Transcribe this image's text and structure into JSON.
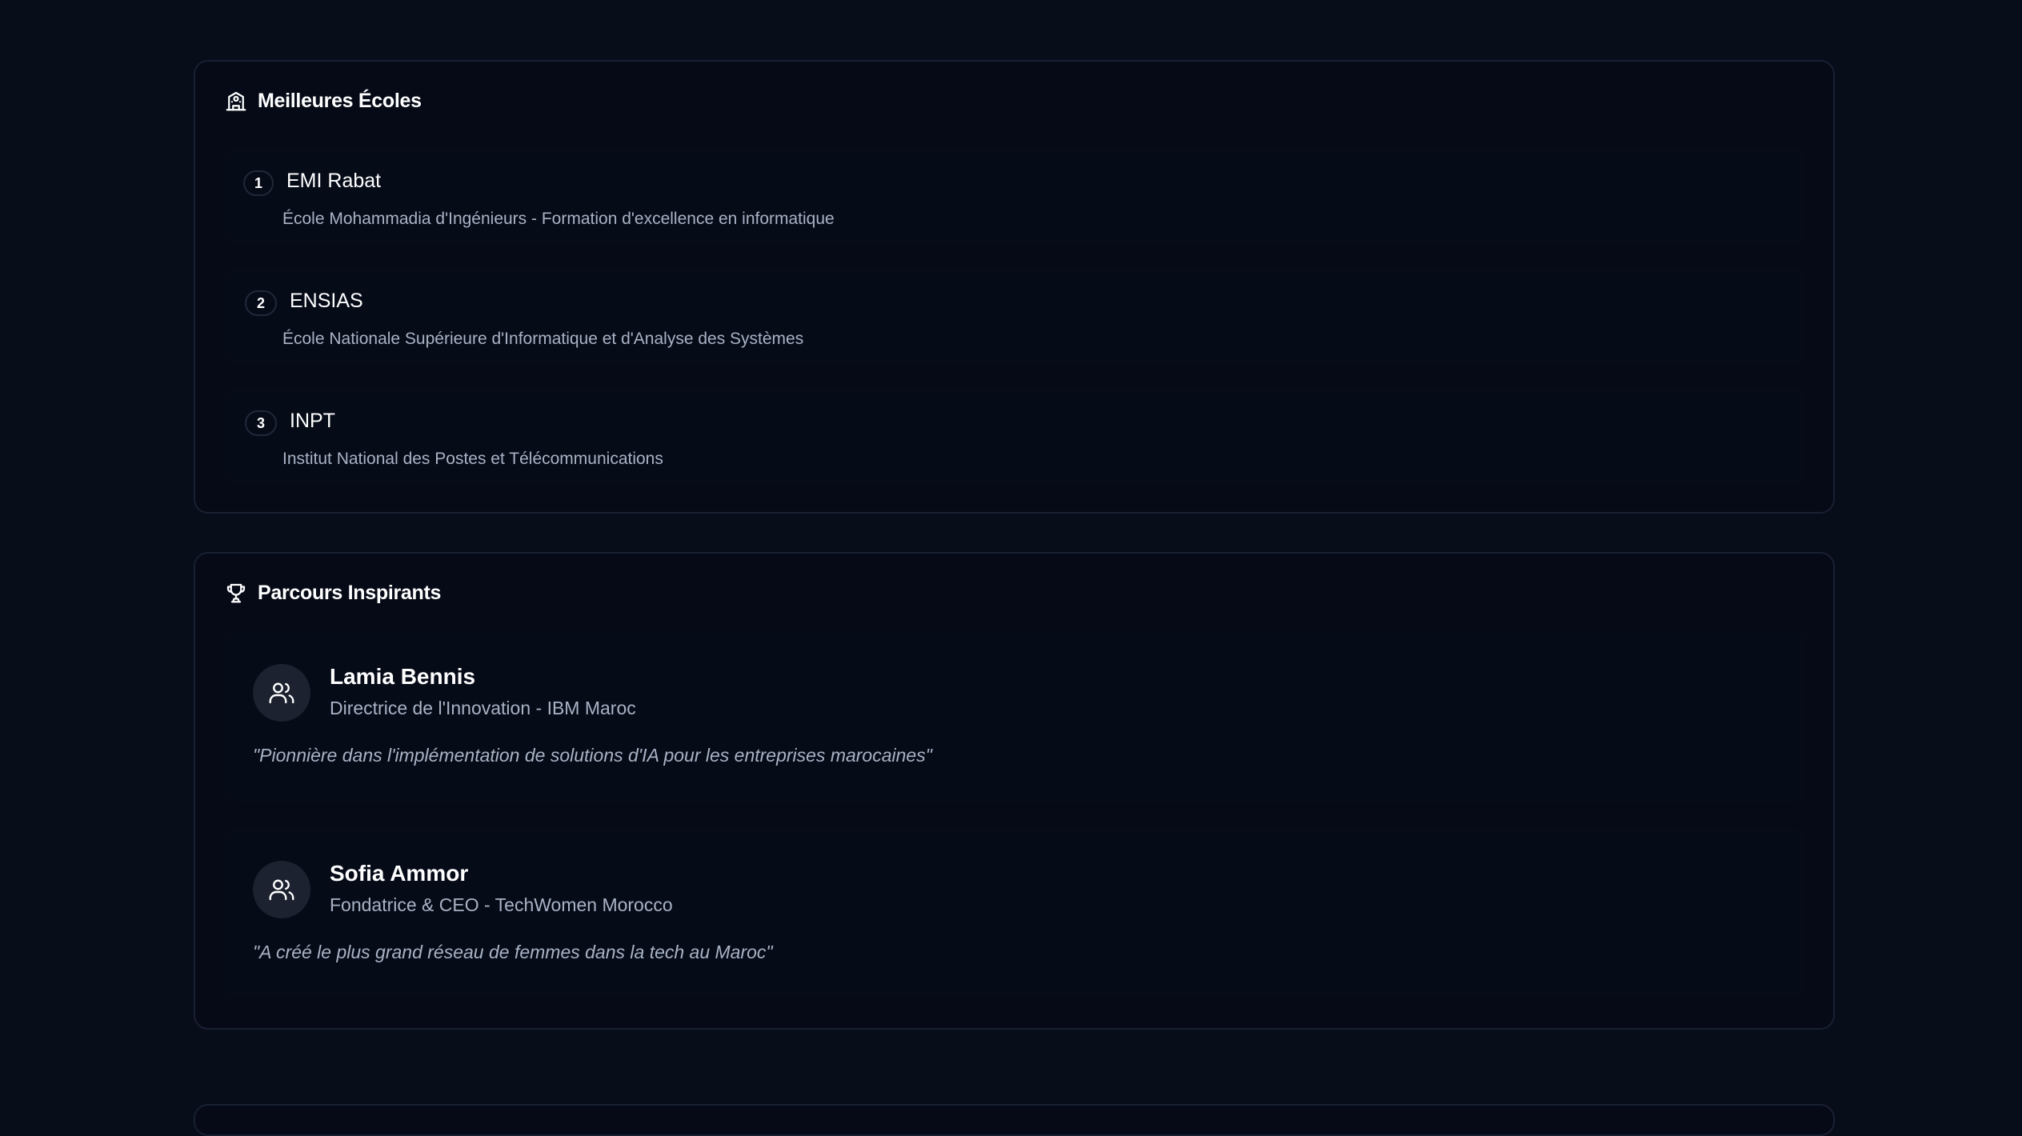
{
  "schools": {
    "title": "Meilleures Écoles",
    "icon": "school-icon",
    "items": [
      {
        "rank": "1",
        "name": "EMI Rabat",
        "description": "École Mohammadia d'Ingénieurs - Formation d'excellence en informatique"
      },
      {
        "rank": "2",
        "name": "ENSIAS",
        "description": "École Nationale Supérieure d'Informatique et d'Analyse des Systèmes"
      },
      {
        "rank": "3",
        "name": "INPT",
        "description": "Institut National des Postes et Télécommunications"
      }
    ]
  },
  "mentors": {
    "title": "Parcours Inspirants",
    "icon": "trophy-icon",
    "items": [
      {
        "name": "Lamia Bennis",
        "role": "Directrice de l'Innovation - IBM Maroc",
        "quote": "\"Pionnière dans l'implémentation de solutions d'IA pour les entreprises marocaines\"",
        "icon": "users-icon"
      },
      {
        "name": "Sofia Ammor",
        "role": "Fondatrice & CEO - TechWomen Morocco",
        "quote": "\"A créé le plus grand réseau de femmes dans la tech au Maroc\"",
        "icon": "users-icon"
      }
    ]
  },
  "colors": {
    "background": "#080d1a",
    "card": "#050a16",
    "border": "#182032",
    "muted_text": "#a8b3c4",
    "avatar_bg": "#1c2230"
  }
}
